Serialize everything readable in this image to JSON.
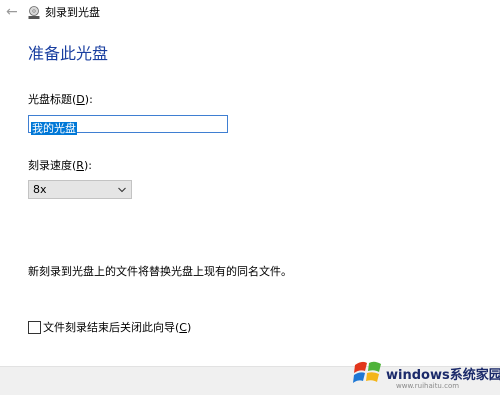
{
  "window": {
    "title": "刻录到光盘",
    "back_icon": "back-arrow-icon",
    "title_icon": "disc-burn-icon"
  },
  "heading": "准备此光盘",
  "disc_title": {
    "label": "光盘标题(D):",
    "label_prefix": "光盘标题(",
    "label_accesskey": "D",
    "label_suffix": "):",
    "value": "我的光盘"
  },
  "speed": {
    "label_prefix": "刻录速度(",
    "label_accesskey": "R",
    "label_suffix": "):",
    "selected": "8x",
    "icon": "chevron-down-icon"
  },
  "info_text": "新刻录到光盘上的文件将替换光盘上现有的同名文件。",
  "close_wizard": {
    "label_prefix": "文件刻录结束后关闭此向导(",
    "label_accesskey": "C",
    "label_suffix": ")",
    "checked": false
  },
  "watermark": {
    "brand": "windows系统家园",
    "url": "www.ruihaitu.com"
  },
  "colors": {
    "heading": "#1a3fa0",
    "selection": "#0078d7",
    "footer_bg": "#f0f0f0"
  }
}
